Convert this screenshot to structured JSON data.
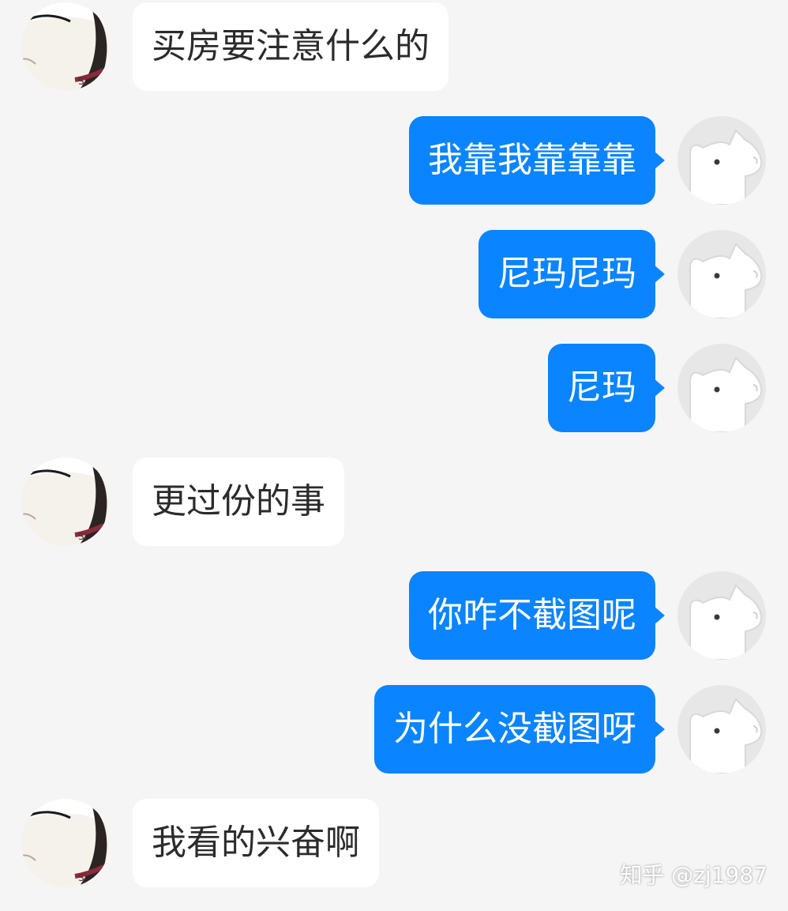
{
  "messages": [
    {
      "side": "in",
      "text": "买房要注意什么的"
    },
    {
      "side": "out",
      "text": "我靠我靠靠靠"
    },
    {
      "side": "out",
      "text": "尼玛尼玛"
    },
    {
      "side": "out",
      "text": "尼玛"
    },
    {
      "side": "in",
      "text": "更过份的事"
    },
    {
      "side": "out",
      "text": "你咋不截图呢"
    },
    {
      "side": "out",
      "text": "为什么没截图呀"
    },
    {
      "side": "in",
      "text": "我看的兴奋啊"
    }
  ],
  "colors": {
    "background": "#f5f5f5",
    "incoming_bubble": "#ffffff",
    "outgoing_bubble": "#0b84ff",
    "incoming_text": "#2b2b2b",
    "outgoing_text": "#ffffff"
  },
  "watermark": "知乎 @zj1987"
}
